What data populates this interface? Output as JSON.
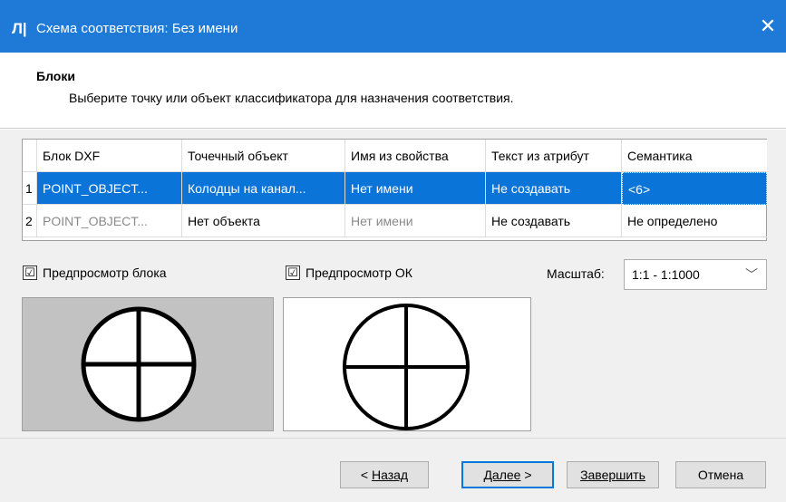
{
  "window": {
    "icon_glyph": "Л|",
    "title": "Схема соответствия: Без имени",
    "close_glyph": "✕"
  },
  "header": {
    "title": "Блоки",
    "subtitle": "Выберите точку или объект классификатора для назначения соответствия."
  },
  "table": {
    "columns": [
      "Блок DXF",
      "Точечный объект",
      "Имя из свойства",
      "Текст из атрибут",
      "Семантика"
    ],
    "rows": [
      {
        "num": "1",
        "cells": [
          "POINT_OBJECT...",
          "Колодцы  на канал...",
          "Нет имени",
          "Не создавать",
          "<6>"
        ],
        "selected": true
      },
      {
        "num": "2",
        "cells": [
          "POINT_OBJECT...",
          "Нет объекта",
          "Нет имени",
          "Не создавать",
          "Не определено"
        ],
        "selected": false
      }
    ]
  },
  "options": {
    "preview_block_label": "Предпросмотр блока",
    "preview_block_checked": "☑",
    "preview_ok_label": "Предпросмотр ОК",
    "preview_ok_checked": "☑",
    "scale_label": "Масштаб:",
    "scale_value": "1:1 - 1:1000",
    "scale_chevron": "﹀"
  },
  "colors": {
    "titlebar": "#1e7ad6",
    "selection": "#0a74d8",
    "preview_block_bg": "#c2c2c2"
  },
  "buttons": {
    "back_prefix": "< ",
    "back_label": "Назад",
    "next_label": "Далее",
    "next_suffix": " >",
    "finish_label": "Завершить",
    "cancel_label": "Отмена"
  }
}
